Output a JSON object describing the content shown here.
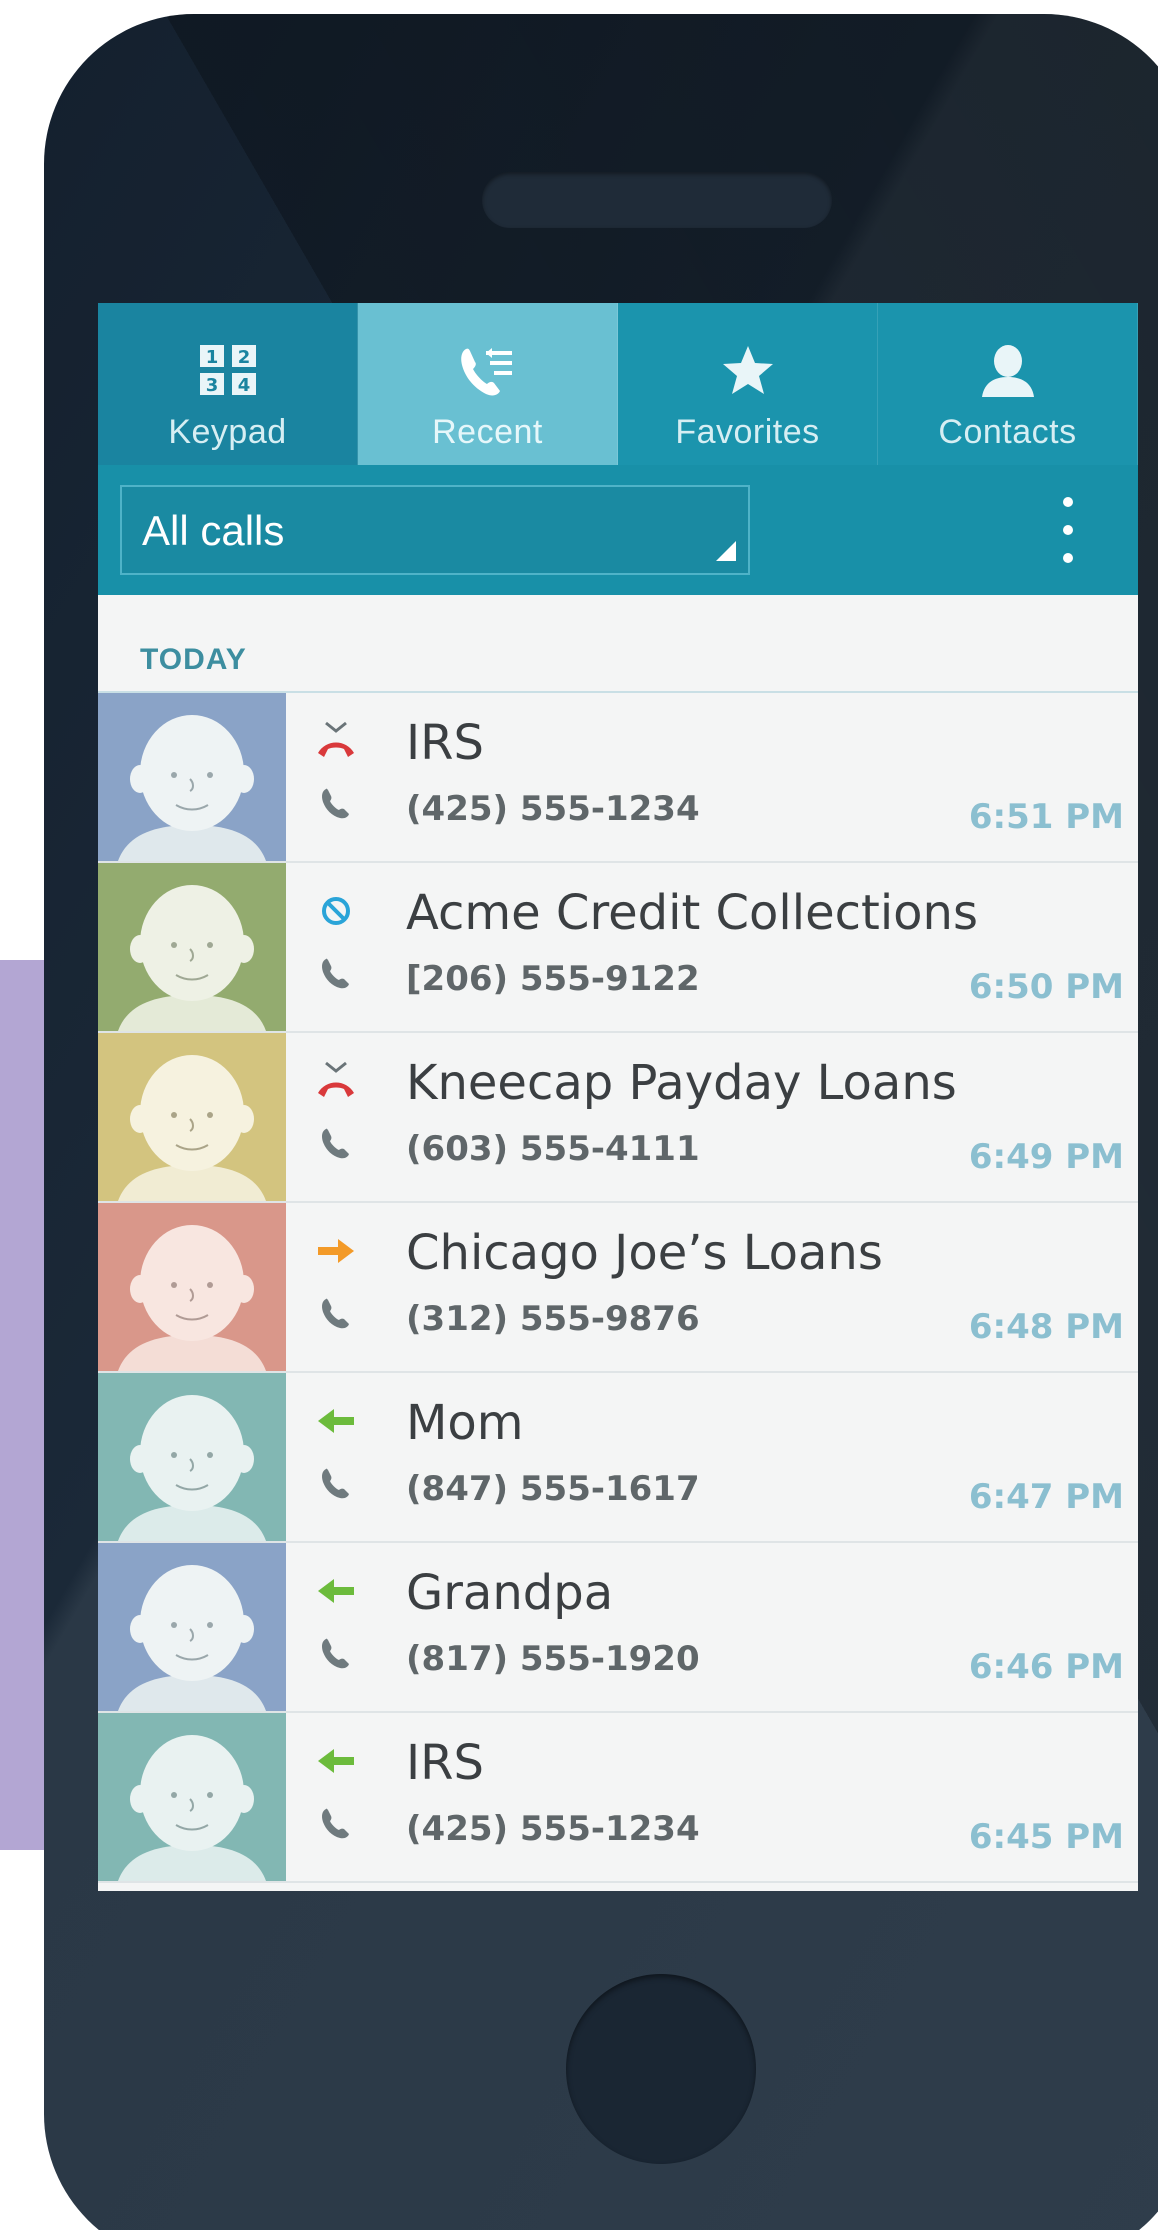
{
  "tabs": [
    {
      "label": "Keypad",
      "icon": "keypad-icon",
      "active": false
    },
    {
      "label": "Recent",
      "icon": "recent-calls-icon",
      "active": true
    },
    {
      "label": "Favorites",
      "icon": "star-icon",
      "active": false
    },
    {
      "label": "Contacts",
      "icon": "contact-icon",
      "active": false
    }
  ],
  "filter": {
    "selected": "All calls"
  },
  "section": {
    "title": "TODAY"
  },
  "calls": [
    {
      "name": "IRS",
      "number": "(425) 555-1234",
      "time": "6:51 PM",
      "type": "missed",
      "avatar_color": "#8aa3c7"
    },
    {
      "name": "Acme Credit Collections",
      "number": "[206) 555-9122",
      "time": "6:50 PM",
      "type": "blocked",
      "avatar_color": "#93ab6f"
    },
    {
      "name": "Kneecap Payday Loans",
      "number": "(603) 555-4111",
      "time": "6:49 PM",
      "type": "missed",
      "avatar_color": "#d3c47f"
    },
    {
      "name": "Chicago Joe’s Loans",
      "number": "(312) 555-9876",
      "time": "6:48 PM",
      "type": "outgoing",
      "avatar_color": "#d9978a"
    },
    {
      "name": "Mom",
      "number": "(847) 555-1617",
      "time": "6:47 PM",
      "type": "incoming",
      "avatar_color": "#82b7b3"
    },
    {
      "name": "Grandpa",
      "number": "(817) 555-1920",
      "time": "6:46 PM",
      "type": "incoming",
      "avatar_color": "#8aa3c7"
    },
    {
      "name": "IRS",
      "number": "(425) 555-1234",
      "time": "6:45 PM",
      "type": "incoming",
      "avatar_color": "#82b7b3"
    }
  ],
  "colors": {
    "tab_bar": "#1b94ad",
    "tab_active": "#69c0d2",
    "time_text": "#8bbfd0",
    "missed": "#d9393b",
    "blocked": "#2aa4d8",
    "outgoing": "#f39a28",
    "incoming": "#6cbb3c",
    "accent_block": "#b3a6d3"
  }
}
